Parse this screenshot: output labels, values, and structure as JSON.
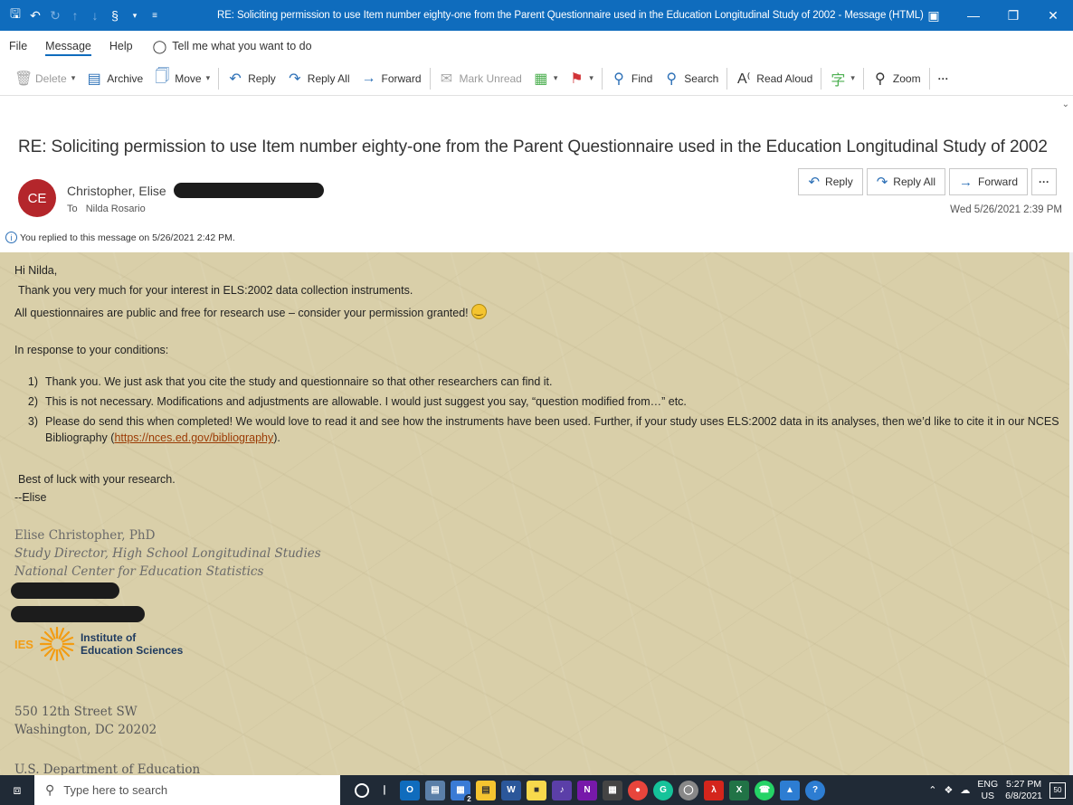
{
  "window": {
    "title": "RE: Soliciting permission to use Item number eighty-one from the Parent Questionnaire used in the Education Longitudinal Study of 2002  -  Message (HTML)"
  },
  "menu": {
    "file": "File",
    "message": "Message",
    "help": "Help",
    "tell_me": "Tell me what you want to do"
  },
  "ribbon": {
    "delete": "Delete",
    "archive": "Archive",
    "move": "Move",
    "reply": "Reply",
    "reply_all": "Reply All",
    "forward": "Forward",
    "mark_unread": "Mark Unread",
    "find": "Find",
    "search": "Search",
    "read_aloud": "Read Aloud",
    "zoom": "Zoom",
    "more": "···"
  },
  "message": {
    "subject": "RE: Soliciting permission to use Item number eighty-one from the Parent Questionnaire used in the Education Longitudinal Study of 2002",
    "avatar_initials": "CE",
    "sender": "Christopher, Elise",
    "to_label": "To",
    "to": "Nilda Rosario",
    "replied_notice": "You replied to this message on 5/26/2021 2:42 PM.",
    "date": "Wed 5/26/2021 2:39 PM",
    "actions": {
      "reply": "Reply",
      "reply_all": "Reply All",
      "forward": "Forward",
      "more": "···"
    }
  },
  "body": {
    "greeting": "Hi Nilda,",
    "line1": "Thank you very much for your interest in ELS:2002 data collection instruments.",
    "line2": "All questionnaires are public and free for research use – consider your permission granted!",
    "conditions_intro": "In response to your conditions:",
    "items": [
      {
        "num": "1)",
        "text": "Thank you. We just ask that you cite the study and questionnaire so that other researchers can find it."
      },
      {
        "num": "2)",
        "text": "This is not necessary. Modifications and adjustments are allowable. I would just suggest you say, “question modified from…” etc."
      },
      {
        "num": "3)",
        "text": "Please do send this when completed! We would love to read it and see how the instruments have been used. Further, if your study uses ELS:2002 data in its analyses, then we’d like to cite it in our NCES Bibliography",
        "link": "https://nces.ed.gov/bibliography",
        "after": ")."
      }
    ],
    "closing": "Best of luck with your research.",
    "signoff": "--Elise",
    "sig_name": "Elise Christopher, PhD",
    "sig_title": "Study Director, High School Longitudinal Studies",
    "sig_org": "National Center for Education Statistics",
    "logo_letters": "IES",
    "logo_line1": "Institute of",
    "logo_line2": "Education Sciences",
    "address1": "550 12th Street SW",
    "address2": "Washington, DC 20202",
    "address3": "U.S. Department of Education"
  },
  "taskbar": {
    "search_placeholder": "Type here to search",
    "lang1": "ENG",
    "lang2": "US",
    "time": "5:27 PM",
    "date": "6/8/2021",
    "notif_count": "50",
    "badge": "2"
  }
}
